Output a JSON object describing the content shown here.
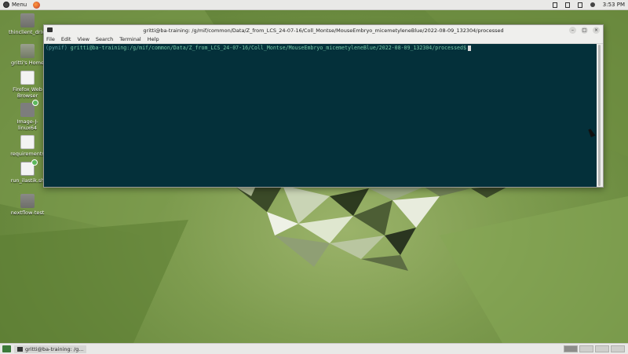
{
  "top_panel": {
    "menu_label": "Menu",
    "clock": "3:53 PM",
    "tray_icons": [
      "network-icon",
      "bluetooth-icon",
      "battery-icon",
      "volume-icon"
    ]
  },
  "desktop_icons": [
    {
      "label": "thinclient_drives",
      "icon": "folder-icon"
    },
    {
      "label": "gritti's Home",
      "icon": "home-folder-icon"
    },
    {
      "label": "Firefox Web Browser",
      "icon": "document-icon"
    },
    {
      "label": "Image-J-linux64",
      "icon": "gear-icon"
    },
    {
      "label": "requirements",
      "icon": "document-icon"
    },
    {
      "label": "run_ilastik.sh",
      "icon": "script-icon"
    },
    {
      "label": "nextflow-test",
      "icon": "folder-icon"
    }
  ],
  "terminal": {
    "title": "gritti@ba-training: /g/mif/common/Data/Z_from_LCS_24-07-16/Coll_Montse/MouseEmbryo_micemetyleneBlue/2022-08-09_132304/processed",
    "menu": [
      "File",
      "Edit",
      "View",
      "Search",
      "Terminal",
      "Help"
    ],
    "prompt_env": "(pynif)",
    "prompt_path": "gritti@ba-training:/g/mif/common/Data/Z_from_LCS_24-07-16/Coll_Montse/MouseEmbryo_micemetyleneBlue/2022-08-09_132304/processed$",
    "window_buttons": [
      "–",
      "□",
      "×"
    ]
  },
  "taskbar": {
    "task_label": "gritti@ba-training: /g..."
  }
}
